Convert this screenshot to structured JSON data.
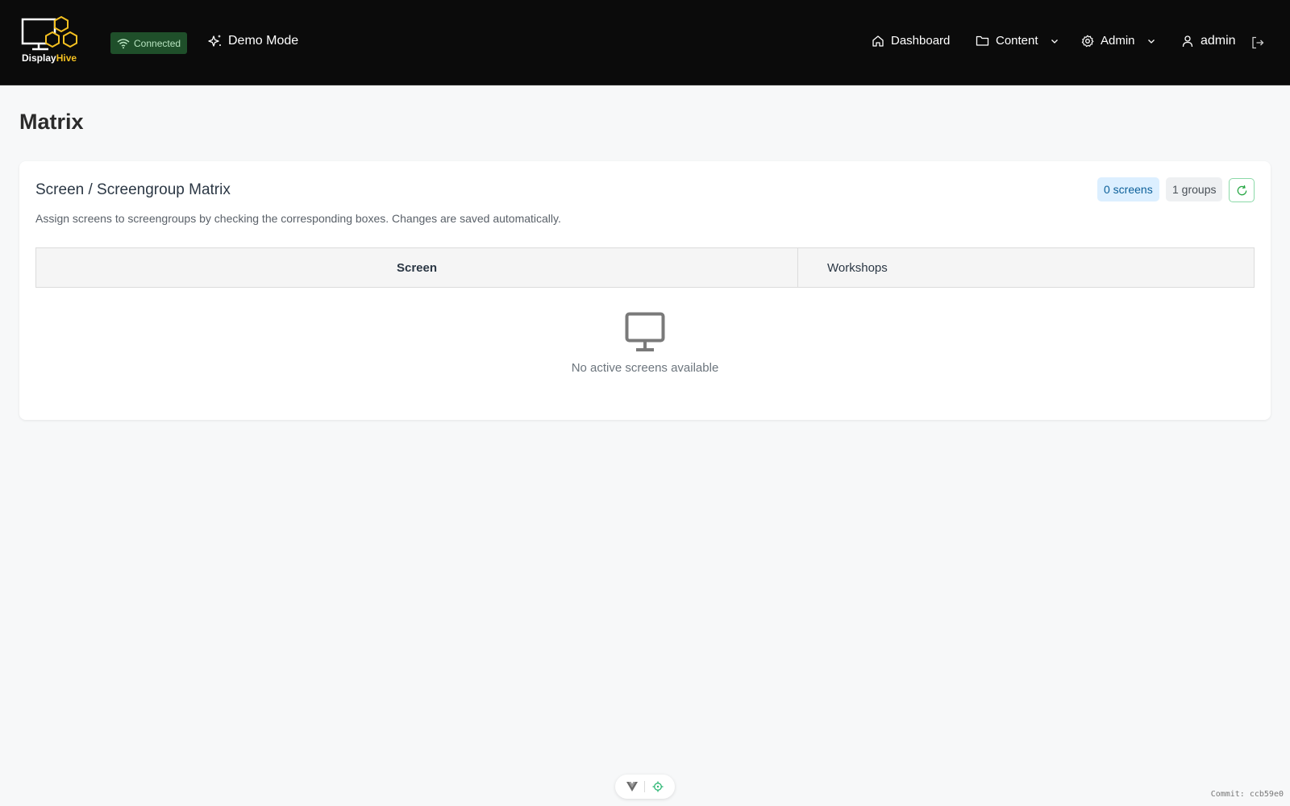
{
  "navbar": {
    "brand_part1": "Display",
    "brand_part2": "Hive",
    "connection_label": "Connected",
    "demo_label": "Demo Mode",
    "items": [
      {
        "label": "Dashboard",
        "icon": "home-icon"
      },
      {
        "label": "Content",
        "icon": "folder-icon"
      },
      {
        "label": "Admin",
        "icon": "gear-icon"
      }
    ],
    "user_label": "admin",
    "colors": {
      "background": "#0b0b0b",
      "brand_accent": "#f4c020",
      "connected": "#1f4f2a"
    }
  },
  "page": {
    "title": "Matrix"
  },
  "card": {
    "title": "Screen / Screengroup Matrix",
    "description": "Assign screens to screengroups by checking the corresponding boxes. Changes are saved automatically.",
    "screens_count_label": "0 screens",
    "groups_count_label": "1 groups",
    "table": {
      "columns": [
        "Screen",
        "Workshops"
      ]
    },
    "empty_message": "No active screens available"
  },
  "footer": {
    "commit_label": "Commit: ccb59e0"
  }
}
